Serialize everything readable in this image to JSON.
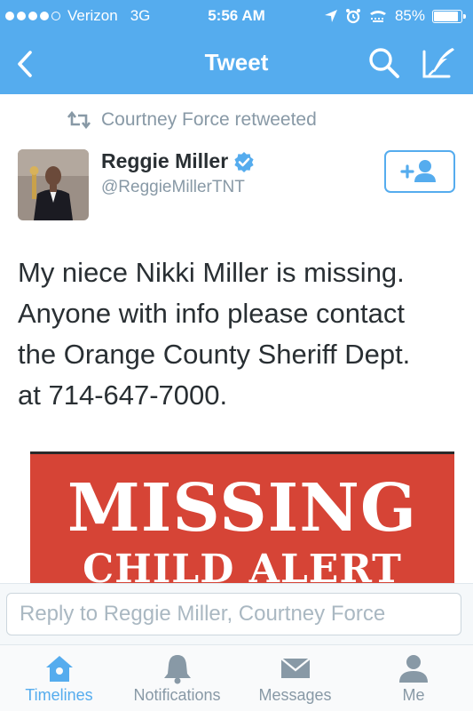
{
  "status_bar": {
    "carrier": "Verizon",
    "network": "3G",
    "time": "5:56 AM",
    "battery": "85%",
    "battery_level": 0.85,
    "signal_bars": 4
  },
  "nav": {
    "title": "Tweet",
    "back_icon": "chevron-left-icon",
    "search_icon": "search-icon",
    "compose_icon": "compose-icon"
  },
  "tweet": {
    "retweet_context": "Courtney Force retweeted",
    "author": {
      "name": "Reggie Miller",
      "handle": "@ReggieMillerTNT",
      "verified": true
    },
    "text_lines": [
      "My niece Nikki Miller is missing.",
      "Anyone with info please contact",
      "the Orange County Sheriff Dept.",
      "at 714-647-7000."
    ],
    "media": {
      "headline": "MISSING",
      "subheadline": "CHILD ALERT"
    }
  },
  "reply": {
    "placeholder": "Reply to Reggie Miller, Courtney Force"
  },
  "tabs": [
    {
      "label": "Timelines",
      "icon": "home-icon",
      "active": true
    },
    {
      "label": "Notifications",
      "icon": "bell-icon",
      "active": false
    },
    {
      "label": "Messages",
      "icon": "envelope-icon",
      "active": false
    },
    {
      "label": "Me",
      "icon": "person-icon",
      "active": false
    }
  ],
  "colors": {
    "brand": "#55acee",
    "text": "#292f33",
    "muted": "#8899a6",
    "media_red": "#d64436"
  }
}
